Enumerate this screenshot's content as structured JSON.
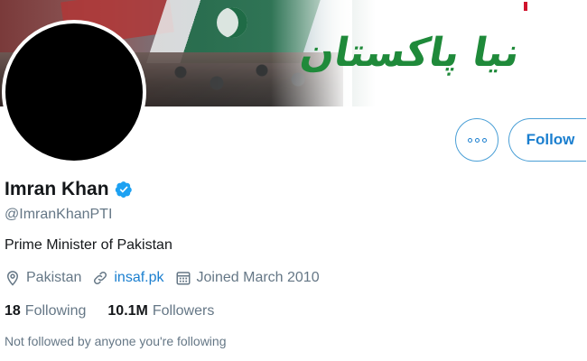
{
  "banner": {
    "urdu_text": "نیا پاکستان"
  },
  "profile": {
    "display_name": "Imran Khan",
    "handle": "@ImranKhanPTI",
    "bio": "Prime Minister of Pakistan",
    "location": "Pakistan",
    "website": "insaf.pk",
    "joined": "Joined March 2010"
  },
  "actions": {
    "follow_label": "Follow"
  },
  "stats": {
    "following_count": "18",
    "following_label": "Following",
    "followers_count": "10.1M",
    "followers_label": "Followers"
  },
  "social_context": "Not followed by anyone you're following",
  "colors": {
    "accent": "#1b7fcf",
    "secondary_text": "#657786",
    "banner_text": "#1f8a3a"
  },
  "icons": [
    "verified-icon",
    "more-icon",
    "location-icon",
    "link-icon",
    "calendar-icon"
  ]
}
